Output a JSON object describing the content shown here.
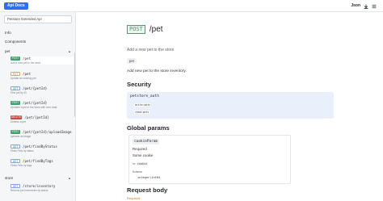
{
  "topbar": {
    "logo": "Api Docs",
    "format": "Json",
    "download_icon": "download-icon",
    "menu_icon": "menu-icon"
  },
  "sidebar": {
    "select_value": "Petstore Extended Api",
    "info": "Info",
    "components": "Components",
    "groups": [
      {
        "name": "pet",
        "caret": "▲"
      },
      {
        "name": "store",
        "caret": "▲"
      }
    ],
    "pet_ops": [
      {
        "method": "POST",
        "path": "/pet",
        "desc": "Add a new pet to the store"
      },
      {
        "method": "PUT",
        "path": "/pet",
        "desc": "Update an existing pet"
      },
      {
        "method": "GET",
        "path": "/pet/{petId}",
        "desc": "Find pet by ID"
      },
      {
        "method": "POST",
        "path": "/pet/{petId}",
        "desc": "Updates a pet in the store with form data"
      },
      {
        "method": "DELETE",
        "path": "/pet/{petId}",
        "desc": "Deletes a pet"
      },
      {
        "method": "POST",
        "path": "/pet/{petId}/uploadImage",
        "desc": "uploads an image"
      },
      {
        "method": "GET",
        "path": "/pet/findByStatus",
        "desc": "Finds Pets by status"
      },
      {
        "method": "GET",
        "path": "/pet/findByTags",
        "desc": "Finds Pets by tags"
      }
    ],
    "store_ops": [
      {
        "method": "GET",
        "path": "/store/inventory",
        "desc": "Returns pet inventories by status"
      }
    ]
  },
  "main": {
    "method": "POST",
    "path": "/pet",
    "summary": "Add a new pet to the store",
    "tag": "pet",
    "description": "Add new pet to the store inventory.",
    "security_heading": "Security",
    "security": {
      "name": "petstore_auth",
      "scopes": [
        "write:pets",
        "read:pets"
      ]
    },
    "global_params_heading": "Global params",
    "param": {
      "name": "cookieParam",
      "required": "Required",
      "description": "Some cookie",
      "in_label": "In:",
      "in_value": "cookie",
      "schema_label": "Schema",
      "type": "integer(int64"
    },
    "request_body_heading": "Request body",
    "request_body_required": "Required"
  }
}
